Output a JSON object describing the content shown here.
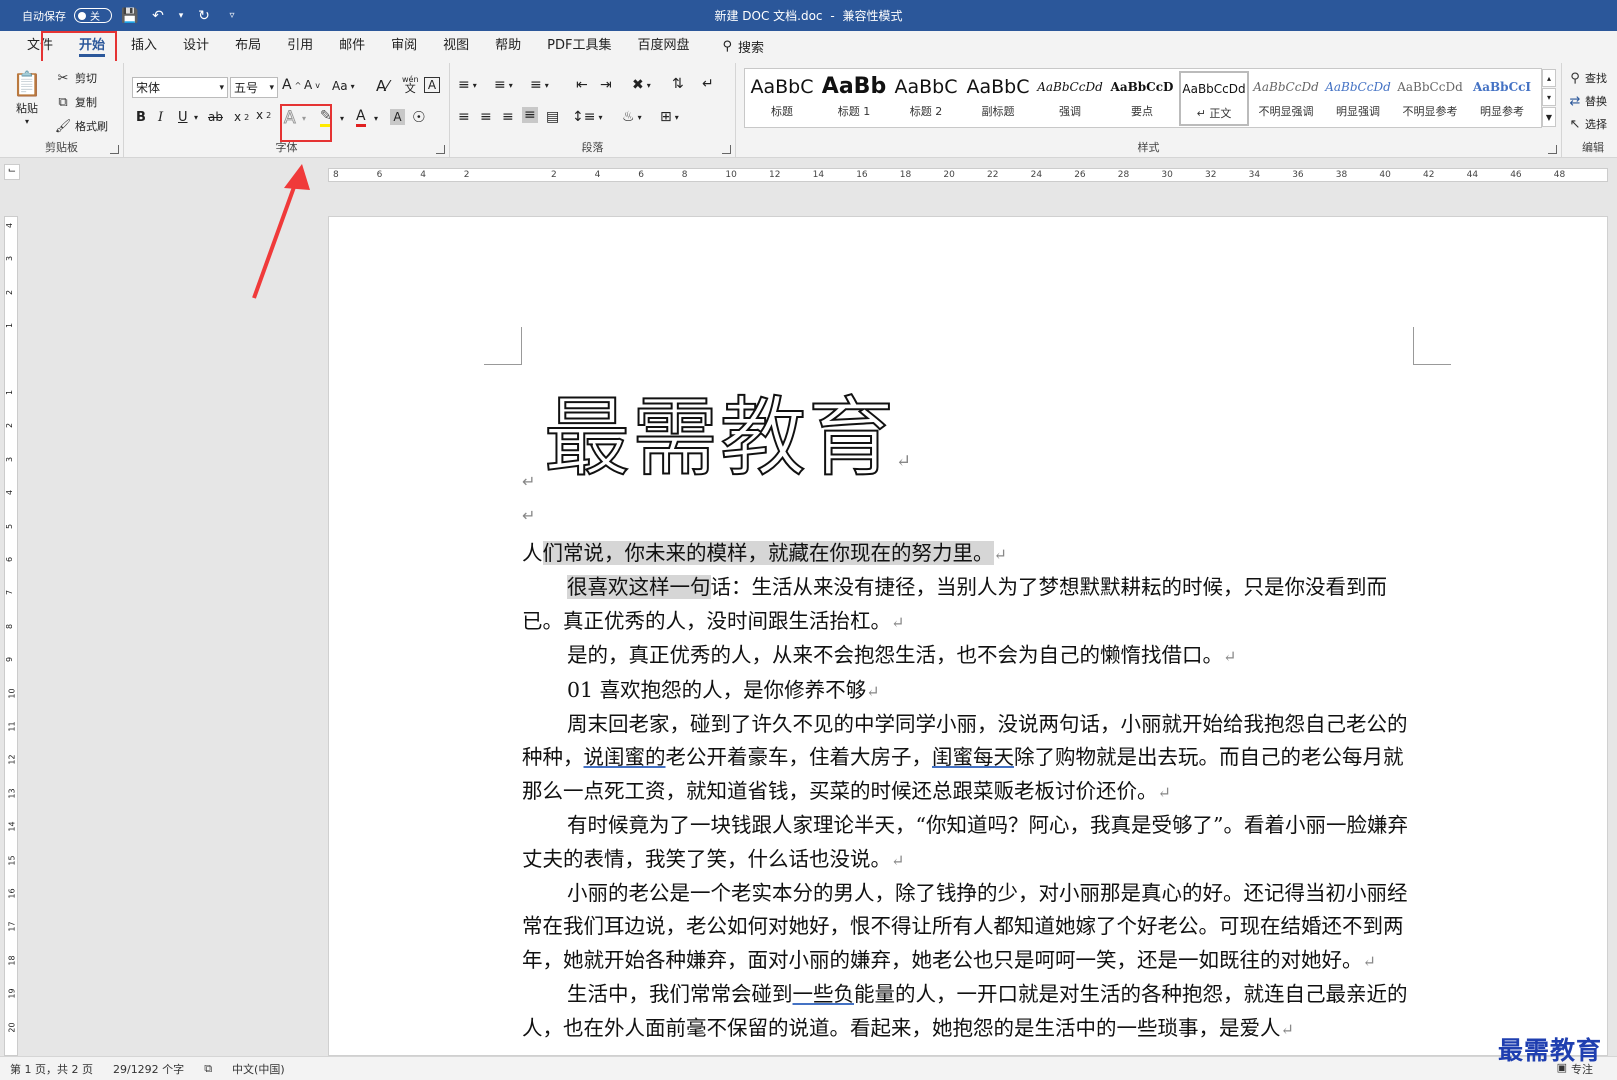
{
  "titlebar": {
    "autosave_label": "自动保存",
    "autosave_state": "关",
    "title": "新建 DOC 文档.doc",
    "separator": "-",
    "mode": "兼容性模式"
  },
  "menu": {
    "items": [
      "文件",
      "开始",
      "插入",
      "设计",
      "布局",
      "引用",
      "邮件",
      "审阅",
      "视图",
      "帮助",
      "PDF工具集",
      "百度网盘"
    ],
    "search": "搜索"
  },
  "ribbon": {
    "clipboard": {
      "paste": "粘贴",
      "cut": "剪切",
      "copy": "复制",
      "format_painter": "格式刷",
      "label": "剪贴板"
    },
    "font": {
      "name": "宋体",
      "size": "五号",
      "label": "字体",
      "case_label": "Aa",
      "wen_label": "wén",
      "wen_char": "文"
    },
    "paragraph": {
      "label": "段落"
    },
    "styles": {
      "label": "样式",
      "items": [
        {
          "sample": "AaBbC",
          "name": "标题"
        },
        {
          "sample": "AaBb",
          "name": "标题 1"
        },
        {
          "sample": "AaBbC",
          "name": "标题 2"
        },
        {
          "sample": "AaBbC",
          "name": "副标题"
        },
        {
          "sample": "AaBbCcDd",
          "name": "强调"
        },
        {
          "sample": "AaBbCcD",
          "name": "要点"
        },
        {
          "sample": "AaBbCcDd",
          "name": "↵ 正文"
        },
        {
          "sample": "AaBbCcDd",
          "name": "不明显强调"
        },
        {
          "sample": "AaBbCcDd",
          "name": "明显强调"
        },
        {
          "sample": "AaBbCcDd",
          "name": "不明显参考"
        },
        {
          "sample": "AaBbCcI",
          "name": "明显参考"
        }
      ]
    },
    "editing": {
      "find": "查找",
      "replace": "替换",
      "select": "选择",
      "label": "编辑"
    }
  },
  "ruler": {
    "h_ticks": [
      "8",
      "6",
      "4",
      "2",
      "",
      "2",
      "4",
      "6",
      "8",
      "10",
      "12",
      "14",
      "16",
      "18",
      "20",
      "22",
      "24",
      "26",
      "28",
      "30",
      "32",
      "34",
      "36",
      "38",
      "40",
      "42",
      "44",
      "46",
      "48"
    ],
    "v_ticks": [
      "4",
      "3",
      "2",
      "1",
      "",
      "1",
      "2",
      "3",
      "4",
      "5",
      "6",
      "7",
      "8",
      "9",
      "10",
      "11",
      "12",
      "13",
      "14",
      "15",
      "16",
      "17",
      "18",
      "19",
      "20"
    ]
  },
  "document": {
    "heading": "最需教育",
    "paragraphs": [
      {
        "segments": [
          {
            "t": "人"
          },
          {
            "t": "们常说，你未来的模样，就藏在你现在的努力里。",
            "hl": true
          }
        ],
        "indent": false
      },
      {
        "segments": [
          {
            "t": "很喜欢这样一句",
            "hl": true
          },
          {
            "t": "话：生活从来没有捷径，当别人为了梦想默默耕耘的时候，只是你没看到而已。真正优秀的人，没时间跟生活抬杠。"
          }
        ],
        "indent": true
      },
      {
        "segments": [
          {
            "t": "是的，真正优秀的人，从来不会抱怨生活，也不会为自己的懒惰找借口。"
          }
        ],
        "indent": true
      },
      {
        "segments": [
          {
            "t": "01  喜欢抱怨的人，是你修养不够"
          }
        ],
        "indent": true
      },
      {
        "segments": [
          {
            "t": "周末回老家，碰到了许久不见的中学同学小丽，没说两句话，小丽就开始给我抱怨自己老公的种种，"
          },
          {
            "t": "说闺蜜的",
            "u": true
          },
          {
            "t": "老公开着豪车，住着大房子，"
          },
          {
            "t": "闺蜜每天",
            "u": true
          },
          {
            "t": "除了购物就是出去玩。而自己的老公每月就那么一点死工资，就知道省钱，买菜的时候还总跟菜贩老板讨价还价。"
          }
        ],
        "indent": true
      },
      {
        "segments": [
          {
            "t": "有时候竟为了一块钱跟人家理论半天，“你知道吗？阿心，我真是受够了”。看着小丽一脸嫌弃丈夫的表情，我笑了笑，什么话也没说。"
          }
        ],
        "indent": true
      },
      {
        "segments": [
          {
            "t": "小丽的老公是一个老实本分的男人，除了钱挣的少，对小丽那是真心的好。还记得当初小丽经常在我们耳边说，老公如何对她好，恨不得让所有人都知道她嫁了个好老公。可现在结婚还不到两年，她就开始各种嫌弃，面对小丽的嫌弃，她老公也只是呵呵一笑，还是一如既往的对她好。"
          }
        ],
        "indent": true
      },
      {
        "segments": [
          {
            "t": "生活中，我们常常会碰到"
          },
          {
            "t": "一些负",
            "u": true
          },
          {
            "t": "能量的人，一开口就是对生活的各种抱怨，就连自己最亲近的人，也在外人面前毫不保留的说道。看起来，她抱怨的是生活中的一些琐事，是爱人"
          }
        ],
        "indent": true
      }
    ]
  },
  "status": {
    "page": "第 1 页，共 2 页",
    "words": "29/1292 个字",
    "language": "中文(中国)",
    "focus": "专注"
  },
  "watermark": "最需教育"
}
